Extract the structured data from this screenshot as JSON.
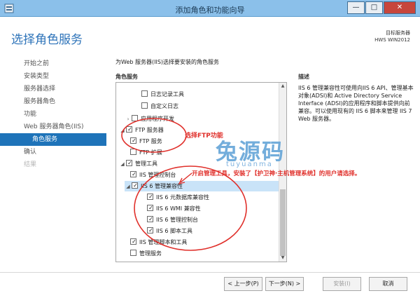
{
  "window": {
    "title": "添加角色和功能向导",
    "min_label": "—",
    "max_label": "□",
    "close_label": "✕"
  },
  "page": {
    "title": "选择角色服务",
    "destination_label": "目标服务器",
    "destination_server": "HWS WIN2012"
  },
  "sidebar": {
    "items": [
      {
        "label": "开始之前"
      },
      {
        "label": "安装类型"
      },
      {
        "label": "服务器选择"
      },
      {
        "label": "服务器角色"
      },
      {
        "label": "功能"
      },
      {
        "label": "Web 服务器角色(IIS)"
      },
      {
        "label": "角色服务"
      },
      {
        "label": "确认"
      },
      {
        "label": "结果"
      }
    ]
  },
  "main": {
    "intro": "为Web 服务器(IIS)选择要安装的角色服务",
    "role_services_label": "角色服务",
    "description_label": "描述",
    "description_text": "IIS 6 管理兼容性可使用向IIS 6 API、管理基本对象(ADSI)和 Active Directory Service Interface (ADSI)的应用程序和脚本提供向前兼容。可以使用现有的 IIS 6 脚本来管理 IIS 7 Web 服务器。",
    "tree": [
      {
        "label": "日志记录工具",
        "checked": false
      },
      {
        "label": "自定义日志",
        "checked": false
      },
      {
        "label": "应用程序开发",
        "checked": false
      },
      {
        "label": "FTP 服务器",
        "checked": true
      },
      {
        "label": "FTP 服务",
        "checked": true
      },
      {
        "label": "FTP 扩展",
        "checked": false
      },
      {
        "label": "管理工具",
        "checked": true
      },
      {
        "label": "IIS 管理控制台",
        "checked": true
      },
      {
        "label": "IIS 6 管理兼容性",
        "checked": true
      },
      {
        "label": "IIS 6 元数据库兼容性",
        "checked": true
      },
      {
        "label": "IIS 6 WMI 兼容性",
        "checked": true
      },
      {
        "label": "IIS 6 管理控制台",
        "checked": true
      },
      {
        "label": "IIS 6 脚本工具",
        "checked": true
      },
      {
        "label": "IIS 管理脚本和工具",
        "checked": true
      },
      {
        "label": "管理服务",
        "checked": false
      }
    ]
  },
  "buttons": {
    "prev": "< 上一步(P)",
    "next": "下一步(N) >",
    "install": "安装(I)",
    "cancel": "取消"
  },
  "annotations": {
    "ftp": "选择FTP功能",
    "main": "开启管理工具，安装了【护卫神·主机管理系统】的用户请选择。"
  },
  "watermark": {
    "title": "兔源码",
    "subtitle": "tuyuanma"
  },
  "colors": {
    "titlebar": "#8bc0ea",
    "accent": "#1e73b9",
    "annotation": "#e0302b",
    "selected_row": "#c9e3f8"
  }
}
